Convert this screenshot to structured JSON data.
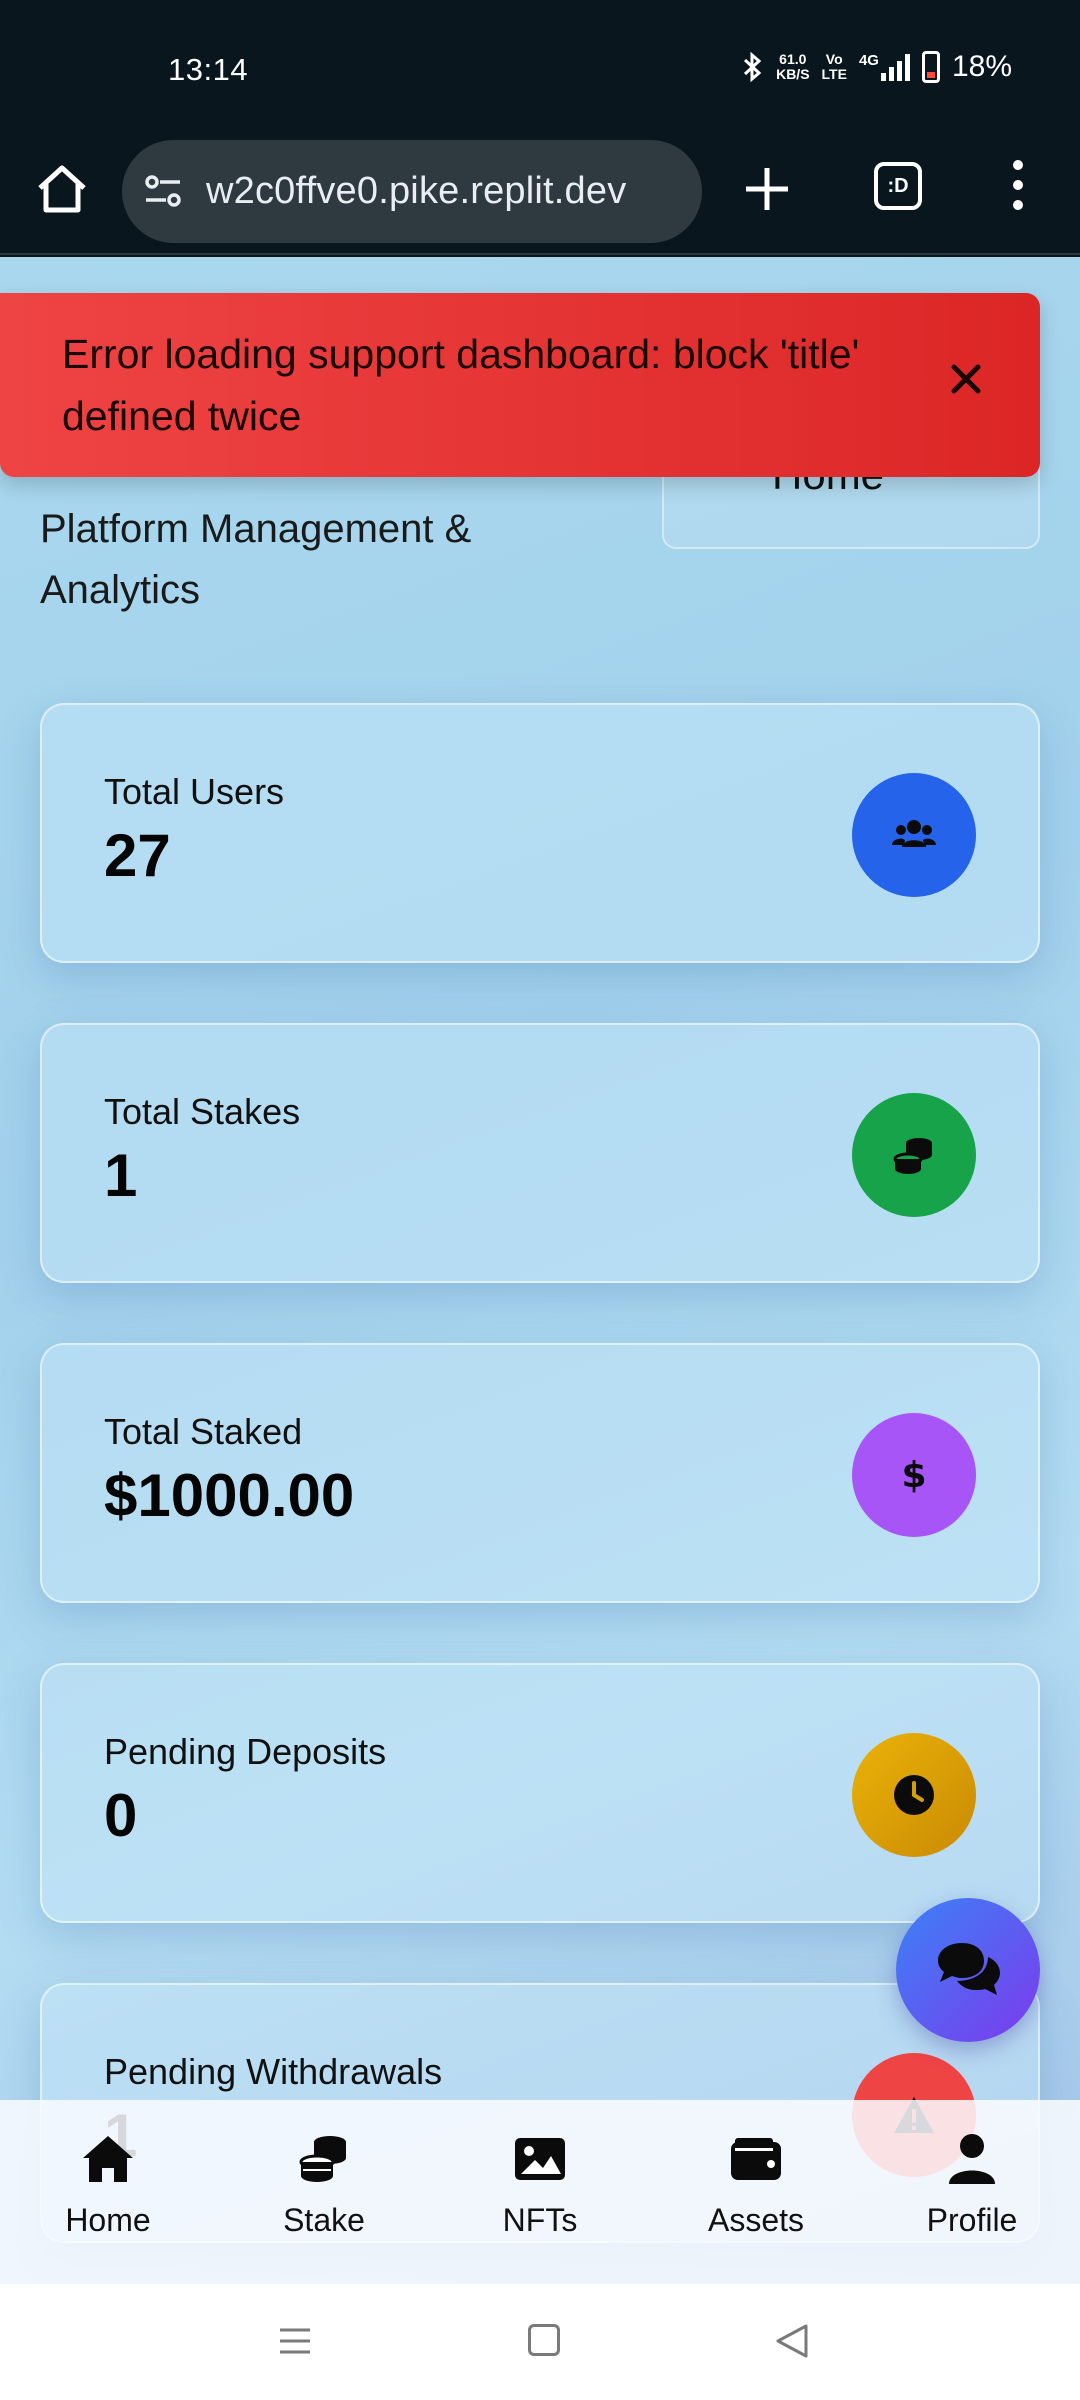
{
  "status_bar": {
    "time": "13:14",
    "network_speed_value": "61.0",
    "network_speed_unit": "KB/S",
    "volte_top": "Vo",
    "volte_bottom": "LTE",
    "network_type": "4G",
    "battery": "18%"
  },
  "browser": {
    "url": "w2c0ffve0.pike.replit.dev",
    "tab_label": ":D"
  },
  "header": {
    "subtitle": "Platform Management & Analytics",
    "home_link_label": "Home"
  },
  "toast": {
    "message": "Error loading support dashboard: block 'title' defined twice"
  },
  "stats": [
    {
      "label": "Total Users",
      "value": "27",
      "icon": "users-icon",
      "color": "#2563eb"
    },
    {
      "label": "Total Stakes",
      "value": "1",
      "icon": "coins-icon",
      "color": "#16a34a"
    },
    {
      "label": "Total Staked",
      "value": "$1000.00",
      "icon": "dollar-icon",
      "color": "#a855f7"
    },
    {
      "label": "Pending Deposits",
      "value": "0",
      "icon": "clock-icon",
      "color": "#d4a008"
    },
    {
      "label": "Pending Withdrawals",
      "value": "1",
      "icon": "warning-icon",
      "color": "#ef4444"
    }
  ],
  "bottom_nav": [
    {
      "label": "Home",
      "icon": "home-icon"
    },
    {
      "label": "Stake",
      "icon": "coins-icon"
    },
    {
      "label": "NFTs",
      "icon": "image-icon"
    },
    {
      "label": "Assets",
      "icon": "wallet-icon"
    },
    {
      "label": "Profile",
      "icon": "user-icon"
    }
  ]
}
